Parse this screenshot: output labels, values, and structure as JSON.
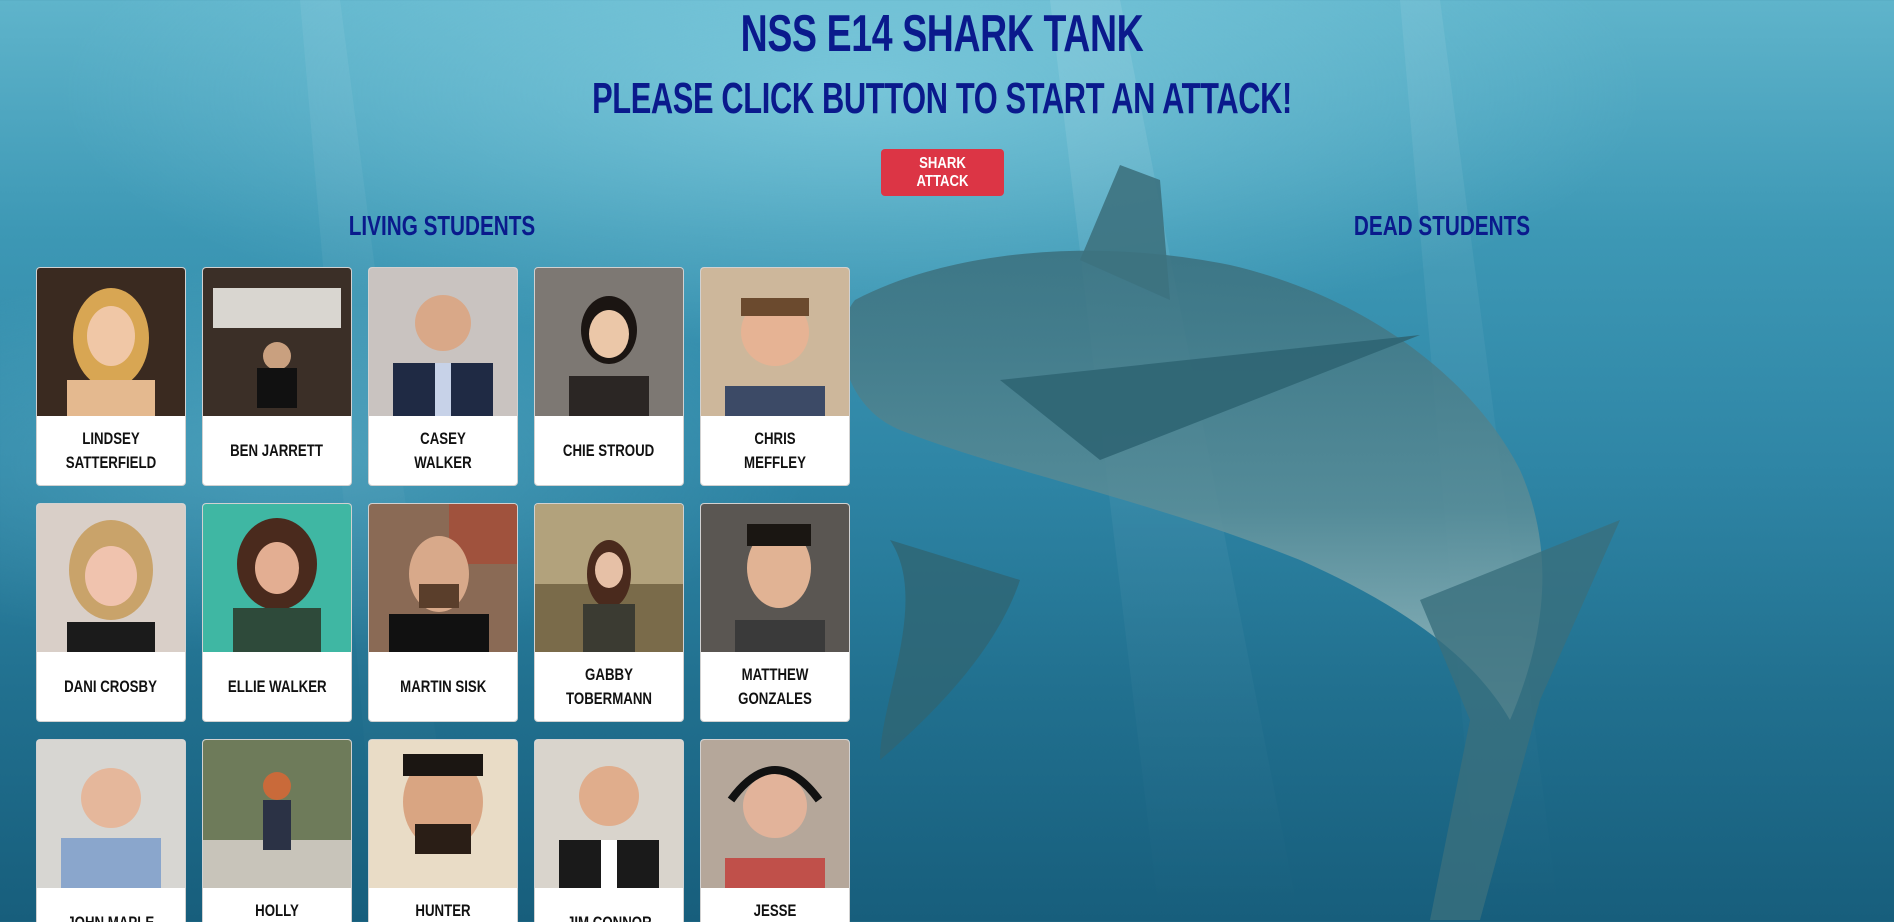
{
  "header": {
    "title": "NSS E14 Shark Tank",
    "subtitle": "Please click button to start an attack!"
  },
  "actions": {
    "attack_label": "Shark Attack"
  },
  "sections": {
    "living_title": "Living Students",
    "dead_title": "Dead Students"
  },
  "colors": {
    "heading": "#0a1a8c",
    "button": "#dc3545",
    "water": "#2f86a6"
  },
  "living_students": [
    {
      "name": "Lindsey Satterfield"
    },
    {
      "name": "Ben Jarrett"
    },
    {
      "name": "Casey Walker"
    },
    {
      "name": "Chie Stroud"
    },
    {
      "name": "Chris Meffley"
    },
    {
      "name": "Dani Crosby"
    },
    {
      "name": "Ellie Walker"
    },
    {
      "name": "Martin Sisk"
    },
    {
      "name": "Gabby Tobermann"
    },
    {
      "name": "Matthew Gonzales"
    },
    {
      "name": "John Maple"
    },
    {
      "name": "Holly Parsons"
    },
    {
      "name": "Hunter Juneau"
    },
    {
      "name": "Jim Connor"
    },
    {
      "name": "Jesse Robinson"
    }
  ],
  "dead_students": []
}
